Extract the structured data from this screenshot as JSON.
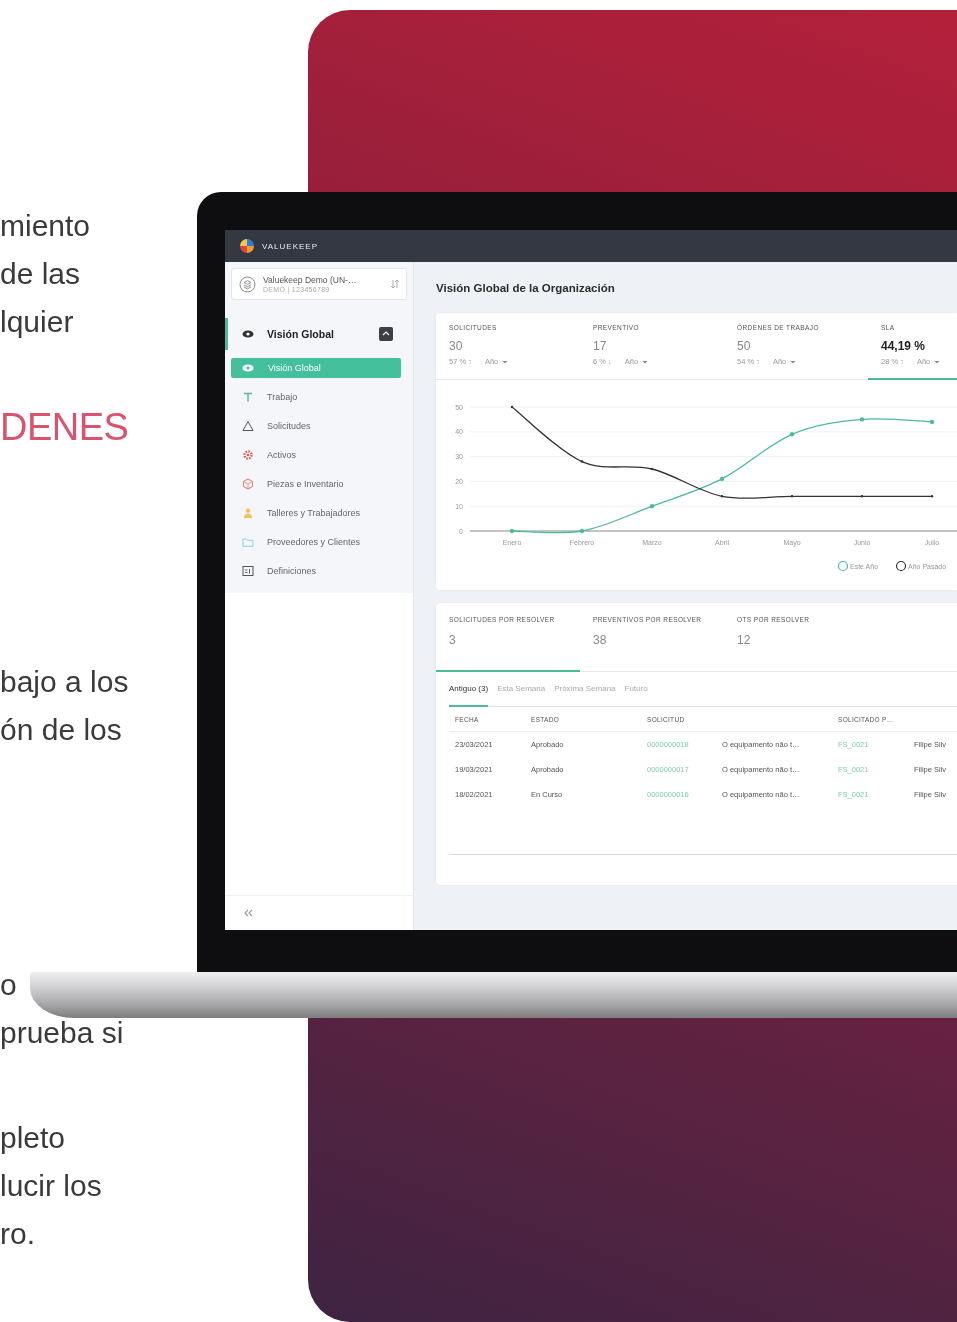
{
  "copy": {
    "paragraphs": [
      {
        "kind": "body",
        "lines": [
          "miento",
          "de las",
          "lquier"
        ]
      },
      {
        "kind": "heading",
        "lines": [
          "DENES"
        ]
      },
      {
        "kind": "body",
        "lines": [
          "bajo a los",
          "ón de los"
        ]
      },
      {
        "kind": "body",
        "lines": [
          "o",
          "prueba si"
        ]
      },
      {
        "kind": "body",
        "lines": [
          "pleto",
          "lucir los",
          "ro."
        ]
      }
    ]
  },
  "app": {
    "brand": "VALUEKEEP",
    "org": {
      "name": "Valuekeep Demo (UN-…",
      "code": "DEMO | 123456789"
    },
    "sidebar": {
      "items": [
        {
          "label": "Visión Global",
          "selected": true,
          "expanded": true,
          "children": [
            {
              "label": "Visión Global",
              "selected": true
            }
          ]
        },
        {
          "label": "Trabajo",
          "selected": false
        },
        {
          "label": "Solicitudes",
          "selected": false
        },
        {
          "label": "Activos",
          "selected": false
        },
        {
          "label": "Piezas e Inventario",
          "selected": false
        },
        {
          "label": "Talleres y Trabajadores",
          "selected": false
        },
        {
          "label": "Proveedores y Clientes",
          "selected": false
        },
        {
          "label": "Definiciones",
          "selected": false
        }
      ]
    },
    "page_title": "Visión Global de la Organización",
    "kpis": [
      {
        "label": "SOLICITUDES",
        "value": "30",
        "change": "57 % ↑",
        "period": "Año",
        "selected": false
      },
      {
        "label": "PREVENTIVO",
        "value": "17",
        "change": "6 % ↓",
        "period": "Año",
        "selected": false
      },
      {
        "label": "ÓRDENES DE TRABAJO",
        "value": "50",
        "change": "54 % ↑",
        "period": "Año",
        "selected": false
      },
      {
        "label": "SLA",
        "value": "44,19 %",
        "change": "28 % ↑",
        "period": "Año",
        "selected": true
      }
    ],
    "chart_data": {
      "type": "line",
      "categories": [
        "Enero",
        "Febrero",
        "Marzo",
        "Abril",
        "Mayo",
        "Junio",
        "Julio"
      ],
      "ylim": [
        0,
        50
      ],
      "yticks": [
        0,
        10,
        20,
        30,
        40,
        50
      ],
      "grid": true,
      "legend": true,
      "series": [
        {
          "name": "Este Año",
          "color": "#4dbb9b",
          "values": [
            0,
            0,
            10,
            21,
            39,
            45,
            44
          ]
        },
        {
          "name": "Año Pasado",
          "color": "#333333",
          "values": [
            50,
            28,
            25,
            14,
            14,
            14,
            14
          ]
        }
      ]
    },
    "pending": [
      {
        "label": "SOLICITUDES POR RESOLVER",
        "value": "3",
        "selected": true
      },
      {
        "label": "PREVENTIVOS POR RESOLVER",
        "value": "38",
        "selected": false
      },
      {
        "label": "OTS POR RESOLVER",
        "value": "12",
        "selected": false
      }
    ],
    "tabs": [
      {
        "label": "Antiguo (3)",
        "selected": true
      },
      {
        "label": "Esta Semana",
        "selected": false
      },
      {
        "label": "Próxima Semana",
        "selected": false
      },
      {
        "label": "Futuro",
        "selected": false
      }
    ],
    "table": {
      "columns": [
        {
          "label": "FECHA",
          "kind": "text"
        },
        {
          "label": "ESTADO",
          "kind": "text"
        },
        {
          "label": "SOLICITUD",
          "kind": "link"
        },
        {
          "kind": "text"
        },
        {
          "label": "SOLICITADO P…",
          "kind": "link"
        },
        {
          "kind": "text"
        }
      ],
      "rows": [
        [
          "23/03/2021",
          "Aprobado",
          "0000000018",
          "O equipamento não t…",
          "FS_0021",
          "Filipe Silv"
        ],
        [
          "19/03/2021",
          "Aprobado",
          "0000000017",
          "O equipamento não t…",
          "FS_0021",
          "Filipe Silv"
        ],
        [
          "18/02/2021",
          "En Curso",
          "0000000016",
          "O equipamento não t…",
          "FS_0021",
          "Filipe Silv"
        ]
      ]
    }
  }
}
